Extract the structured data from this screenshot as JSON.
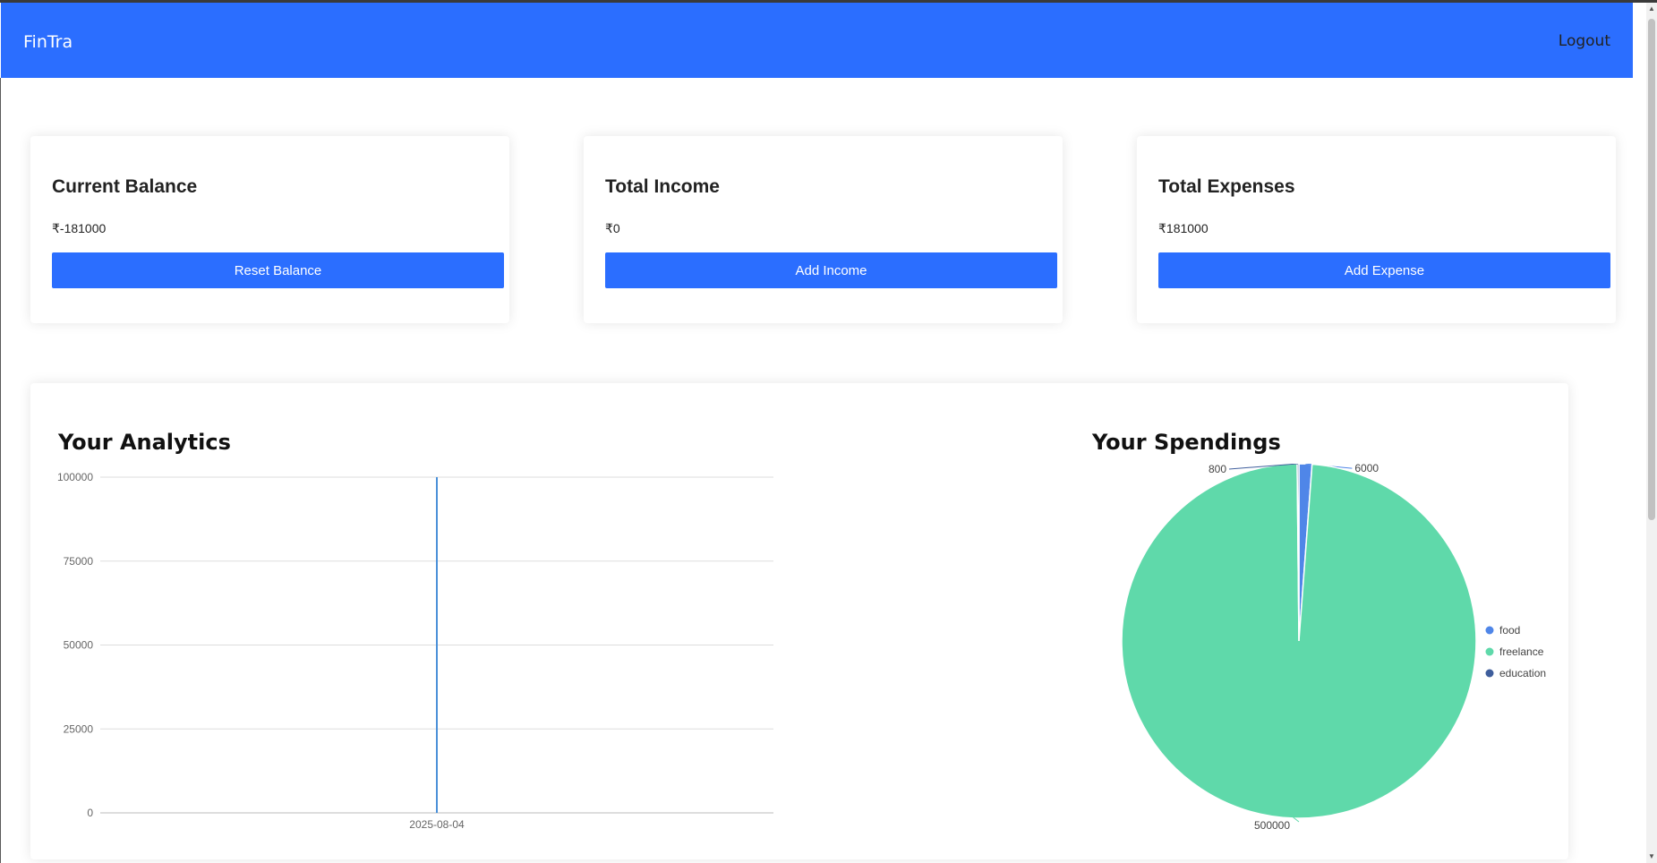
{
  "navbar": {
    "brand": "FinTra",
    "logout_label": "Logout"
  },
  "cards": [
    {
      "title": "Current Balance",
      "value": "₹-181000",
      "button": "Reset Balance"
    },
    {
      "title": "Total Income",
      "value": "₹0",
      "button": "Add Income"
    },
    {
      "title": "Total Expenses",
      "value": "₹181000",
      "button": "Add Expense"
    }
  ],
  "analytics": {
    "title": "Your Analytics",
    "chart_data": {
      "type": "bar",
      "categories": [
        "2025-08-04"
      ],
      "values": [
        100000
      ],
      "yticks": [
        0,
        25000,
        50000,
        75000,
        100000
      ],
      "ylim": [
        0,
        100000
      ],
      "grid": true,
      "colors": {
        "bar": "#4a90d9",
        "grid": "#dddddd"
      }
    }
  },
  "spendings": {
    "title": "Your Spendings",
    "chart_data": {
      "type": "pie",
      "slices": [
        {
          "label": "food",
          "value": 6000,
          "color": "#4f86e8"
        },
        {
          "label": "freelance",
          "value": 500000,
          "color": "#5fd9aa"
        },
        {
          "label": "education",
          "value": 800,
          "color": "#3f5e9c"
        }
      ],
      "value_labels": [
        "6000",
        "500000",
        "800"
      ],
      "legend": "right"
    }
  }
}
